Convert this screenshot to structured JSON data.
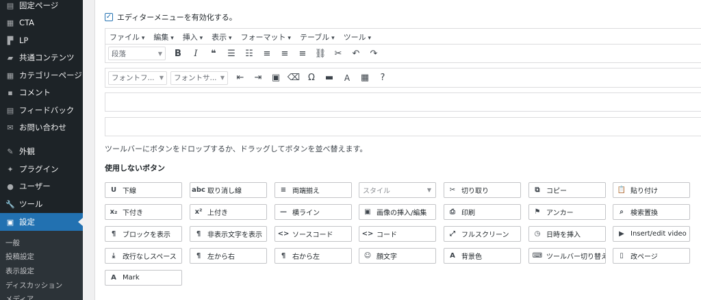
{
  "sidebar": {
    "items": [
      {
        "label": "固定ページ",
        "icon": "page-icon"
      },
      {
        "label": "CTA",
        "icon": "cta-icon"
      },
      {
        "label": "LP",
        "icon": "lp-icon"
      },
      {
        "label": "共通コンテンツ",
        "icon": "folder-icon"
      },
      {
        "label": "カテゴリーページ",
        "icon": "category-icon"
      },
      {
        "label": "コメント",
        "icon": "comment-icon"
      },
      {
        "label": "フィードバック",
        "icon": "feedback-icon"
      },
      {
        "label": "お問い合わせ",
        "icon": "mail-icon"
      },
      {
        "label": "外観",
        "icon": "appearance-icon"
      },
      {
        "label": "プラグイン",
        "icon": "plugin-icon"
      },
      {
        "label": "ユーザー",
        "icon": "user-icon"
      },
      {
        "label": "ツール",
        "icon": "wrench-icon"
      },
      {
        "label": "設定",
        "icon": "settings-icon",
        "active": true
      }
    ],
    "submenu": [
      "一般",
      "投稿設定",
      "表示設定",
      "ディスカッション",
      "メディア"
    ]
  },
  "editor": {
    "enable_label": "エディターメニューを有効化する。",
    "menubar": [
      "ファイル",
      "編集",
      "挿入",
      "表示",
      "フォーマット",
      "テーブル",
      "ツール"
    ],
    "format_select": "段落",
    "font_family_select": "フォントフ...",
    "font_size_select": "フォントサ...",
    "hint": "ツールバーにボタンをドロップするか、ドラッグしてボタンを並べ替えます。",
    "unused_heading": "使用しないボタン"
  },
  "unused_buttons": [
    {
      "label": "下線",
      "icon": "U"
    },
    {
      "label": "取り消し線",
      "icon": "abc"
    },
    {
      "label": "両端揃え",
      "icon": "≡"
    },
    {
      "label": "スタイル",
      "icon": ""
    },
    {
      "label": "切り取り",
      "icon": "✂"
    },
    {
      "label": "コピー",
      "icon": "⧉"
    },
    {
      "label": "貼り付け",
      "icon": "📋"
    },
    {
      "label": "下付き",
      "icon": "x₂"
    },
    {
      "label": "上付き",
      "icon": "x²"
    },
    {
      "label": "横ライン",
      "icon": "—"
    },
    {
      "label": "画像の挿入/編集",
      "icon": "▣"
    },
    {
      "label": "印刷",
      "icon": "⎙"
    },
    {
      "label": "アンカー",
      "icon": "⚑"
    },
    {
      "label": "検索置換",
      "icon": "⌕"
    },
    {
      "label": "ブロックを表示",
      "icon": "¶"
    },
    {
      "label": "非表示文字を表示",
      "icon": "¶"
    },
    {
      "label": "ソースコード",
      "icon": "<>"
    },
    {
      "label": "コード",
      "icon": "<>"
    },
    {
      "label": "フルスクリーン",
      "icon": "⤢"
    },
    {
      "label": "日時を挿入",
      "icon": "◷"
    },
    {
      "label": "Insert/edit video",
      "icon": "▶"
    },
    {
      "label": "改行なしスペース",
      "icon": "⤓"
    },
    {
      "label": "左から右",
      "icon": "¶"
    },
    {
      "label": "右から左",
      "icon": "¶"
    },
    {
      "label": "顔文字",
      "icon": "☺"
    },
    {
      "label": "背景色",
      "icon": "A"
    },
    {
      "label": "ツールバー切り替え",
      "icon": "⌨"
    },
    {
      "label": "改ページ",
      "icon": "▯"
    },
    {
      "label": "Mark",
      "icon": "A"
    }
  ],
  "colors": {
    "sidebar_bg": "#1d2327",
    "active_bg": "#2271b1",
    "panel_bg": "#ffffff"
  }
}
